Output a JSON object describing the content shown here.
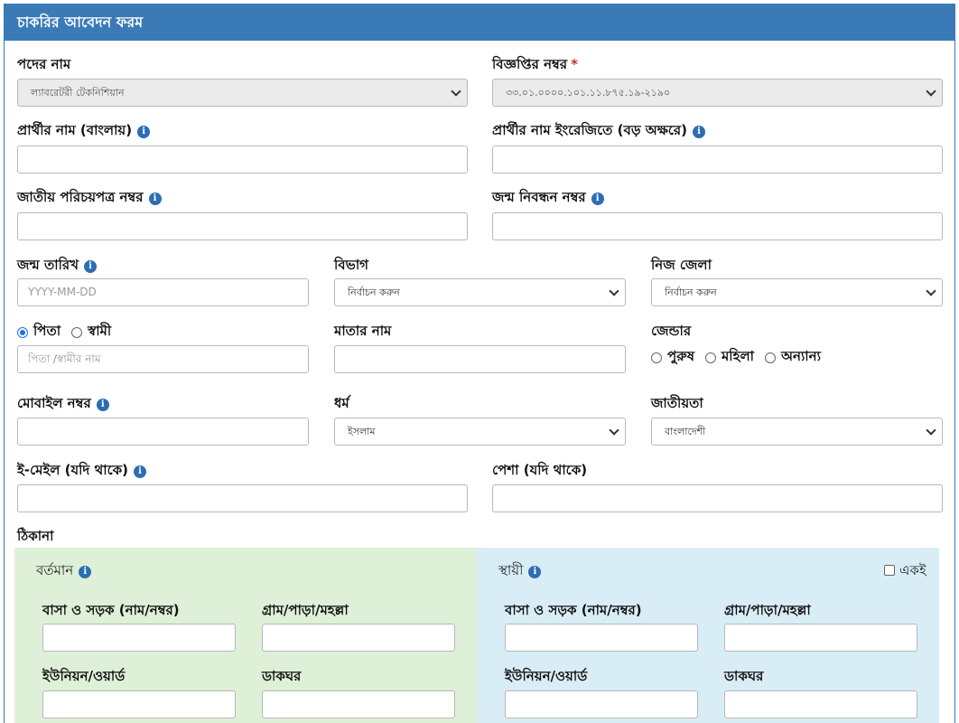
{
  "form": {
    "title": "চাকরির আবেদন ফরম",
    "post_name": {
      "label": "পদের নাম",
      "value": "ল্যাবরেটরী টেকনিশিয়ান"
    },
    "circular_no": {
      "label": "বিজ্ঞপ্তির নম্বর",
      "required_mark": "*",
      "value": "৩৩.০১.০০০০.১০১.১১.৮৭৫.১৯-২১৯০"
    },
    "name_bn": {
      "label": "প্রার্থীর নাম (বাংলায়)",
      "value": ""
    },
    "name_en": {
      "label": "প্রার্থীর নাম ইংরেজিতে (বড় অক্ষরে)",
      "value": ""
    },
    "nid": {
      "label": "জাতীয় পরিচয়পত্র নম্বর",
      "value": ""
    },
    "birth_reg": {
      "label": "জন্ম নিবন্ধন নম্বর",
      "value": ""
    },
    "dob": {
      "label": "জন্ম তারিখ",
      "placeholder": "YYYY-MM-DD"
    },
    "division": {
      "label": "বিভাগ",
      "value": "নির্বাচন করুন"
    },
    "home_district": {
      "label": "নিজ জেলা",
      "value": "নির্বাচন করুন"
    },
    "guardian": {
      "option_father": "পিতা",
      "option_husband": "স্বামী",
      "selected": "পিতা",
      "placeholder": "পিতা /স্বামীর নাম"
    },
    "mother_name": {
      "label": "মাতার নাম",
      "value": ""
    },
    "gender": {
      "label": "জেন্ডার",
      "options": [
        "পুরুষ",
        "মহিলা",
        "অন্যান্য"
      ]
    },
    "mobile": {
      "label": "মোবাইল নম্বর",
      "value": ""
    },
    "religion": {
      "label": "ধর্ম",
      "value": "ইসলাম"
    },
    "nationality": {
      "label": "জাতীয়তা",
      "value": "বাংলাদেশী"
    },
    "email": {
      "label": "ই-মেইল (যদি থাকে)",
      "value": ""
    },
    "occupation": {
      "label": "পেশা (যদি থাকে)",
      "value": ""
    },
    "address": {
      "label": "ঠিকানা",
      "present": {
        "title": "বর্তমান",
        "house_road": "বাসা ও সড়ক (নাম/নম্বর)",
        "village": "গ্রাম/পাড়া/মহল্লা",
        "union_ward": "ইউনিয়ন/ওয়ার্ড",
        "post_office": "ডাকঘর"
      },
      "permanent": {
        "title": "স্থায়ী",
        "same_label": "একই",
        "house_road": "বাসা ও সড়ক (নাম/নম্বর)",
        "village": "গ্রাম/পাড়া/মহল্লা",
        "union_ward": "ইউনিয়ন/ওয়ার্ড",
        "post_office": "ডাকঘর"
      }
    },
    "info_icon_glyph": "i"
  }
}
